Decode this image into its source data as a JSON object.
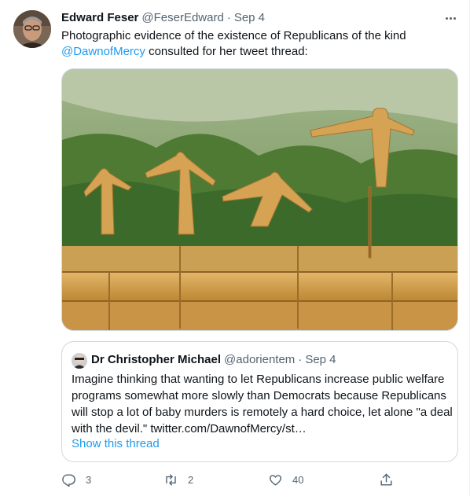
{
  "tweet": {
    "author_name": "Edward Feser",
    "author_handle": "@FeserEdward",
    "separator": "·",
    "date": "Sep 4",
    "text_before": "Photographic evidence of the existence of Republicans of the kind ",
    "mention": "@DawnofMercy",
    "text_after": " consulted for her tweet thread:"
  },
  "quote": {
    "author_name": "Dr Christopher Michael",
    "author_handle": "@adorientem",
    "separator": "·",
    "date": "Sep 4",
    "text": "Imagine thinking that wanting to let Republicans increase public welfare programs somewhat more slowly than Democrats because Republicans will stop a lot of baby murders is remotely a hard choice, let alone \"a deal with the devil.\" twitter.com/DawnofMercy/st…",
    "show_thread": "Show this thread"
  },
  "actions": {
    "replies": "3",
    "retweets": "2",
    "likes": "40"
  },
  "colors": {
    "link": "#1d9bf0",
    "secondary_text": "#536471",
    "border": "#cfd9de"
  },
  "icons": [
    "more-icon",
    "reply-icon",
    "retweet-icon",
    "like-icon",
    "share-icon"
  ]
}
